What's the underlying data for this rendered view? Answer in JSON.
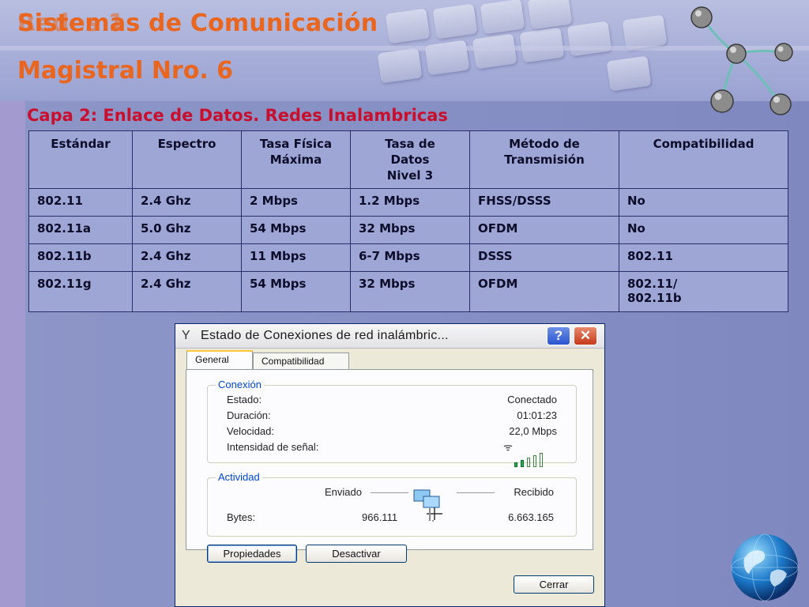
{
  "slide": {
    "title_line_1": "Sistemas de Comunicación",
    "title_line_1_overlay": "Redes 1",
    "title_line_2": "Magistral Nro. 6",
    "subtitle": "Capa 2: Enlace de Datos. Redes Inalambricas"
  },
  "table": {
    "headers": [
      "Estándar",
      "Espectro",
      "Tasa Física\n    Máxima",
      "Tasa de\n   Datos\n  Nivel 3",
      "Método de\n    Transmisión",
      "Compatibilidad"
    ],
    "rows": [
      [
        "802.11",
        "2.4 Ghz",
        "2 Mbps",
        "1.2 Mbps",
        "FHSS/DSSS",
        "No"
      ],
      [
        "802.11a",
        "5.0 Ghz",
        "54 Mbps",
        "32 Mbps",
        "OFDM",
        "No"
      ],
      [
        "802.11b",
        "2.4 Ghz",
        "11 Mbps",
        "6-7 Mbps",
        "DSSS",
        "802.11"
      ],
      [
        "802.11g",
        "2.4 Ghz",
        "54 Mbps",
        "32 Mbps",
        "OFDM",
        "802.11/\n      802.11b"
      ]
    ]
  },
  "dialog": {
    "title": "Estado de Conexiones de red inalámbric...",
    "help_label": "?",
    "close_label": "✕",
    "tabs": [
      "General",
      "Compatibilidad"
    ],
    "connection": {
      "group_label": "Conexión",
      "estado_label": "Estado:",
      "estado_value": "Conectado",
      "duracion_label": "Duración:",
      "duracion_value": "01:01:23",
      "velocidad_label": "Velocidad:",
      "velocidad_value": "22,0 Mbps",
      "senal_label": "Intensidad de señal:",
      "signal_bars_filled": 2,
      "signal_bars_total": 5
    },
    "activity": {
      "group_label": "Actividad",
      "sent_label": "Enviado",
      "received_label": "Recibido",
      "bytes_label": "Bytes:",
      "bytes_sent": "966.111",
      "bytes_received": "6.663.165"
    },
    "buttons": {
      "properties": "Propiedades",
      "disable": "Desactivar",
      "close": "Cerrar"
    }
  },
  "colors": {
    "title": "#e8661f",
    "subtitle": "#c8102e",
    "table_bg": "#9ea6d6",
    "xp_group_title": "#0046d5"
  }
}
